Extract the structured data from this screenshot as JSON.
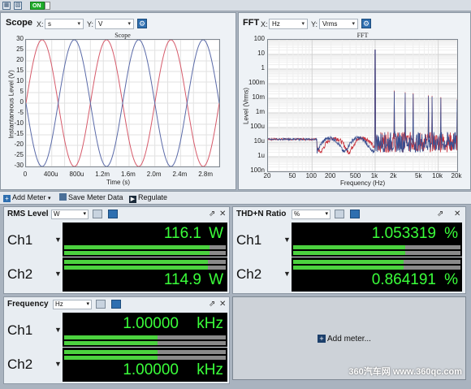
{
  "topbar": {
    "on_label": "ON"
  },
  "scope": {
    "title": "Scope",
    "x_label": "X:",
    "x_unit": "s",
    "y_label": "Y:",
    "y_unit": "V",
    "chart_title": "Scope",
    "y_axis_label": "Instantaneous Level (V)",
    "x_axis_label": "Time (s)",
    "y_ticks": [
      "30",
      "25",
      "20",
      "15",
      "10",
      "5",
      "0",
      "-5",
      "-10",
      "-15",
      "-20",
      "-25",
      "-30"
    ],
    "x_ticks": [
      "0",
      "400u",
      "800u",
      "1.2m",
      "1.6m",
      "2.0m",
      "2.4m",
      "2.8m"
    ]
  },
  "fft": {
    "title": "FFT",
    "x_label": "X:",
    "x_unit": "Hz",
    "y_label": "Y:",
    "y_unit": "Vrms",
    "chart_title": "FFT",
    "y_axis_label": "Level (Vrms)",
    "x_axis_label": "Frequency (Hz)",
    "y_ticks": [
      "100",
      "10",
      "1",
      "100m",
      "10m",
      "1m",
      "100u",
      "10u",
      "1u",
      "100n"
    ],
    "x_ticks": [
      "20",
      "50",
      "100",
      "200",
      "500",
      "1k",
      "2k",
      "5k",
      "10k",
      "20k"
    ]
  },
  "chart_data": [
    {
      "type": "line",
      "title": "Scope",
      "xlabel": "Time (s)",
      "ylabel": "Instantaneous Level (V)",
      "xlim": [
        0,
        0.003
      ],
      "ylim": [
        -30,
        30
      ],
      "grid": true,
      "series": [
        {
          "color": "#d65a6a",
          "frequency_hz": 1000,
          "amplitude": 30,
          "phase": "sine"
        },
        {
          "color": "#5a6aa8",
          "frequency_hz": 1000,
          "amplitude": 30,
          "phase": "inverted sine"
        }
      ]
    },
    {
      "type": "line",
      "title": "FFT",
      "xlabel": "Frequency (Hz)",
      "ylabel": "Level (Vrms)",
      "x_scale": "log",
      "y_scale": "log",
      "xlim": [
        20,
        20000
      ],
      "ylim": [
        1e-07,
        100
      ],
      "grid": true,
      "series": [
        {
          "color": "#c8303a",
          "fundamental_hz": 1000,
          "fundamental_level": 20,
          "noise_floor": 1e-05
        },
        {
          "color": "#3a4f8f",
          "fundamental_hz": 1000,
          "fundamental_level": 20,
          "noise_floor": 1e-05
        }
      ]
    }
  ],
  "toolbar": {
    "add_meter": "Add Meter",
    "save_meter_data": "Save Meter Data",
    "regulate": "Regulate"
  },
  "meters": {
    "rms": {
      "title": "RMS Level",
      "unit_select": "W",
      "ch1_name": "Ch1",
      "ch1_value": "116.1",
      "ch1_unit": "W",
      "ch1_level": 0.9,
      "ch2_name": "Ch2",
      "ch2_value": "114.9",
      "ch2_unit": "W",
      "ch2_level": 0.89
    },
    "thd": {
      "title": "THD+N Ratio",
      "unit_select": "%",
      "ch1_name": "Ch1",
      "ch1_value": "1.053319",
      "ch1_unit": "%",
      "ch1_level": 0.67,
      "ch2_name": "Ch2",
      "ch2_value": "0.864191",
      "ch2_unit": "%",
      "ch2_level": 0.66
    },
    "freq": {
      "title": "Frequency",
      "unit_select": "Hz",
      "ch1_name": "Ch1",
      "ch1_value": "1.00000",
      "ch1_unit": "kHz",
      "ch1_level": 0.58,
      "ch2_name": "Ch2",
      "ch2_value": "1.00000",
      "ch2_unit": "kHz",
      "ch2_level": 0.58
    }
  },
  "add_meter_panel": {
    "label": "Add meter..."
  },
  "watermark": "360汽车网 www.360qc.com"
}
